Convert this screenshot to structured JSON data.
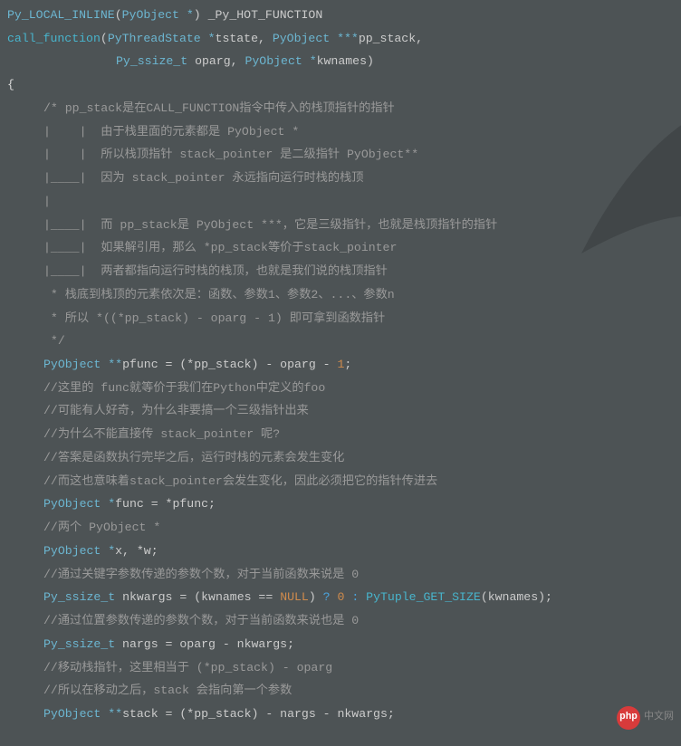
{
  "sig": {
    "ret_macro": "Py_LOCAL_INLINE",
    "ret_type": "PyObject *",
    "hot": "_Py_HOT_FUNCTION",
    "fn": "call_function",
    "p1_type": "PyThreadState *",
    "p1_name": "tstate",
    "p2_type": "PyObject ***",
    "p2_name": "pp_stack",
    "p3_type": "Py_ssize_t",
    "p3_name": "oparg",
    "p4_type": "PyObject *",
    "p4_name": "kwnames"
  },
  "c": {
    "l1": "/* pp_stack是在CALL_FUNCTION指令中传入的栈顶指针的指针",
    "l2": "|    |  由于栈里面的元素都是 PyObject *",
    "l3": "|    |  所以栈顶指针 stack_pointer 是二级指针 PyObject**",
    "l4": "|____|  因为 stack_pointer 永远指向运行时栈的栈顶",
    "l5": "|",
    "l6": "|____|  而 pp_stack是 PyObject ***，它是三级指针，也就是栈顶指针的指针",
    "l7": "|____|  如果解引用，那么 *pp_stack等价于stack_pointer",
    "l8": "|____|  两者都指向运行时栈的栈顶，也就是我们说的栈顶指针",
    "l9": " * 栈底到栈顶的元素依次是：函数、参数1、参数2、...、参数n",
    "l10": " * 所以 *((*pp_stack) - oparg - 1) 即可拿到函数指针",
    "l11": " */",
    "l12": "//这里的 func就等价于我们在Python中定义的foo",
    "l13": "//可能有人好奇，为什么非要搞一个三级指针出来",
    "l14": "//为什么不能直接传 stack_pointer 呢?",
    "l15": "//答案是函数执行完毕之后，运行时栈的元素会发生变化",
    "l16": "//而这也意味着stack_pointer会发生变化，因此必须把它的指针传进去",
    "l17": "//两个 PyObject *",
    "l18": "//通过关键字参数传递的参数个数，对于当前函数来说是 0",
    "l19": "//通过位置参数传递的参数个数，对于当前函数来说也是 0",
    "l20": "//移动栈指针，这里相当于 (*pp_stack) - oparg",
    "l21": "//所以在移动之后，stack 会指向第一个参数"
  },
  "code": {
    "pfunc_type": "PyObject **",
    "pfunc_name": "pfunc",
    "pfunc_rhs1": "(*pp_stack) - oparg - ",
    "pfunc_one": "1",
    "func_type": "PyObject *",
    "func_name": "func",
    "func_rhs": " = *pfunc;",
    "xw_type": "PyObject *",
    "xw_names": "x, *w;",
    "nk_type": "Py_ssize_t",
    "nk_name": "nkwargs",
    "nk_expr1": " = (kwnames == ",
    "nk_null": "NULL",
    "nk_expr2": ") ",
    "nk_q": "?",
    "nk_zero": " 0 ",
    "nk_colon": ":",
    "nk_call": " PyTuple_GET_SIZE",
    "nk_arg": "(kwnames);",
    "nargs_type": "Py_ssize_t",
    "nargs_rhs": " nargs = oparg - nkwargs;",
    "stack_type": "PyObject **",
    "stack_rhs": "stack = (*pp_stack) - nargs - nkwargs;"
  },
  "watermark": {
    "logo": "php",
    "text": "中文网"
  }
}
